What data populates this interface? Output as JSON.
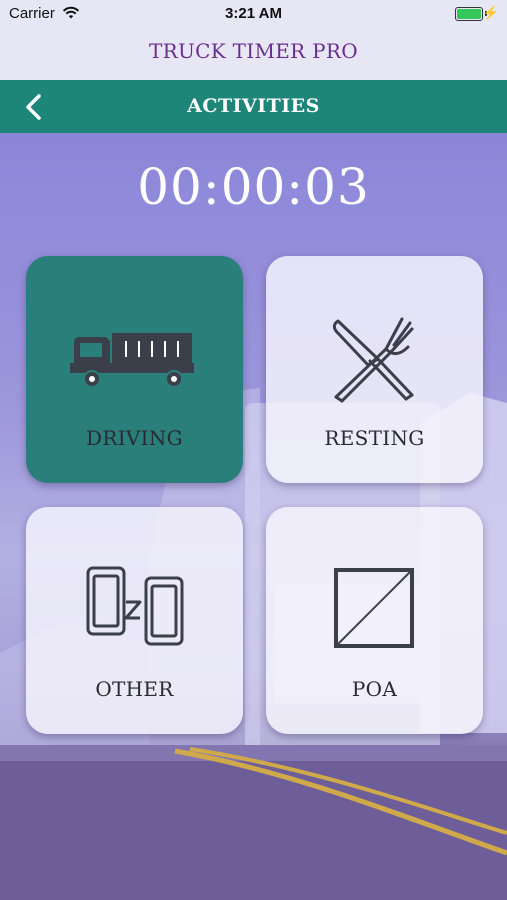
{
  "status_bar": {
    "carrier": "Carrier",
    "time": "3:21 AM",
    "charging_glyph": "⚡"
  },
  "app": {
    "title": "TRUCK TIMER PRO"
  },
  "nav": {
    "title": "ACTIVITIES",
    "back_icon": "chevron-left-icon"
  },
  "timer": {
    "value": "00:00:03"
  },
  "activities": [
    {
      "label": "DRIVING",
      "icon": "truck-icon",
      "active": true
    },
    {
      "label": "RESTING",
      "icon": "fork-knife-icon",
      "active": false
    },
    {
      "label": "OTHER",
      "icon": "phones-icon",
      "active": false
    },
    {
      "label": "POA",
      "icon": "poa-square-icon",
      "active": false
    }
  ],
  "colors": {
    "accent": "#1e8678",
    "active_tile": "#2a7f7a",
    "title_purple": "#6a2e8f",
    "battery": "#34c759"
  }
}
